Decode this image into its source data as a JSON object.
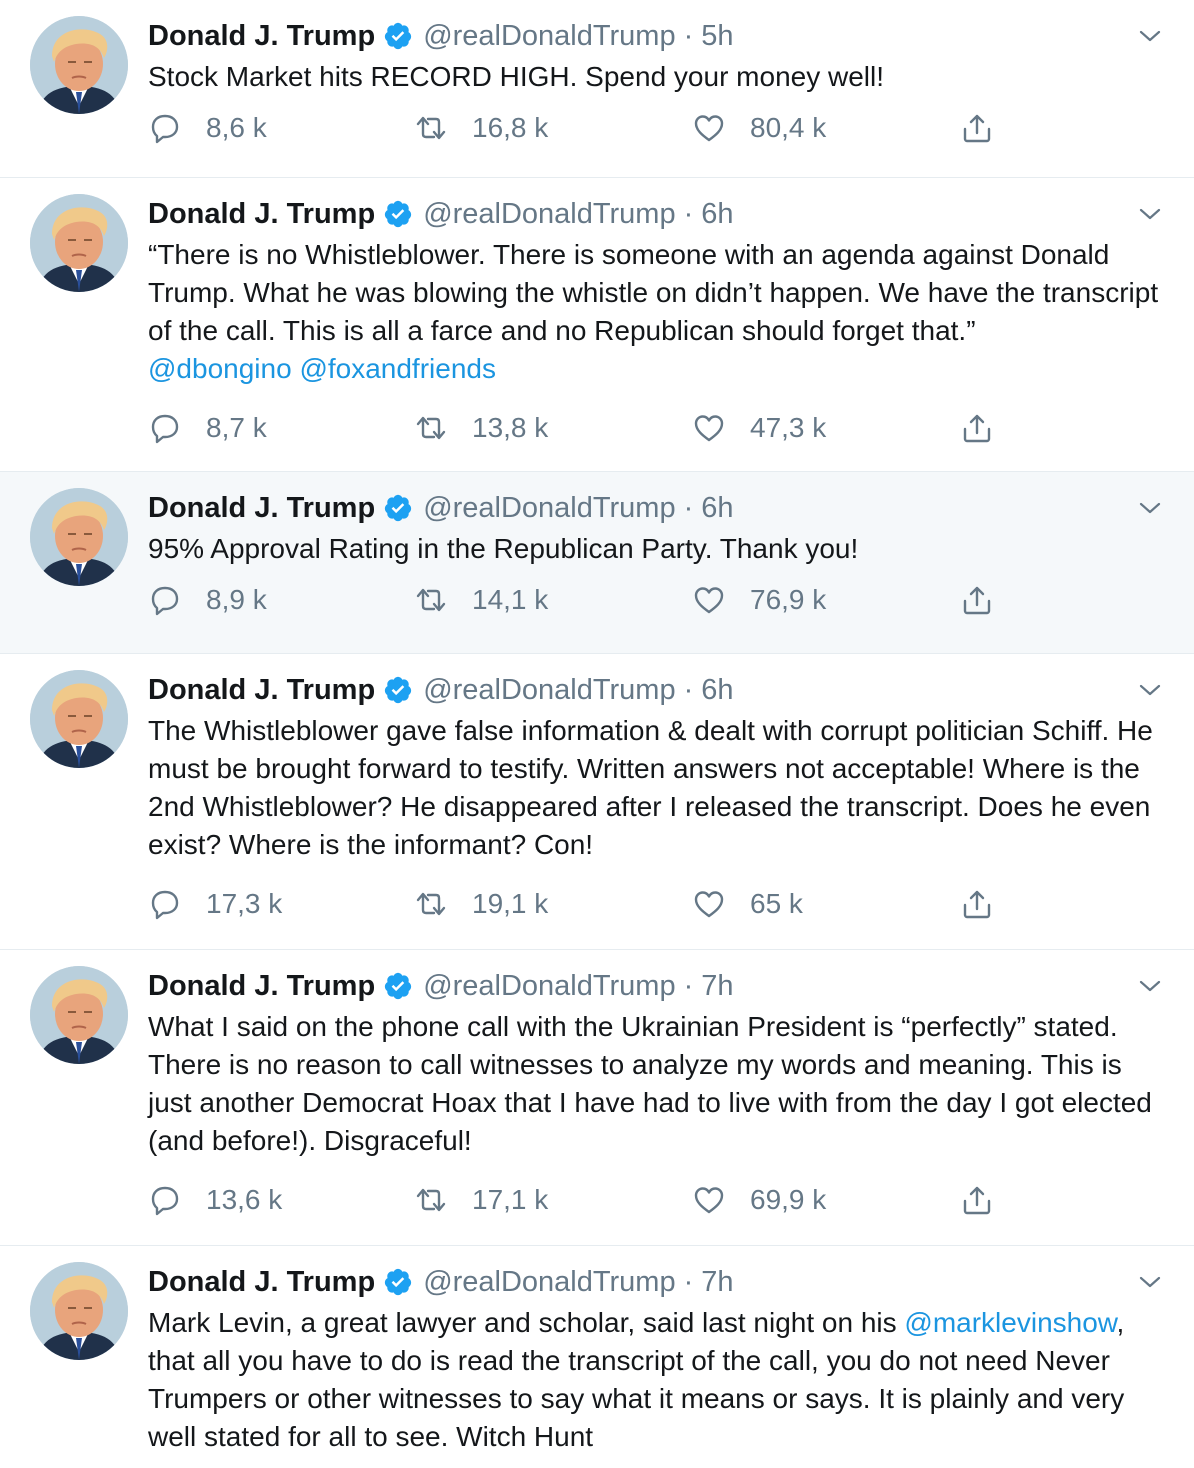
{
  "colors": {
    "text": "#14171a",
    "secondary": "#657786",
    "link": "#1b95e0",
    "verified": "#1da1f2",
    "divider": "#e6ecf0",
    "highlight_bg": "#f5f8fa"
  },
  "icons": {
    "reply": "speech-bubble-icon",
    "retweet": "retweet-icon",
    "like": "heart-icon",
    "share": "share-upload-icon",
    "verified": "verified-badge-icon",
    "caret": "chevron-down-icon"
  },
  "tweets": [
    {
      "name": "Donald J. Trump",
      "handle": "@realDonaldTrump",
      "dot": "·",
      "time": "5h",
      "text": "Stock Market hits RECORD HIGH. Spend your money well!",
      "replies": "8,6 k",
      "retweets": "16,8 k",
      "likes": "80,4 k"
    },
    {
      "name": "Donald J. Trump",
      "handle": "@realDonaldTrump",
      "dot": "·",
      "time": "6h",
      "text": "“There is no Whistleblower. There is someone with an agenda against Donald Trump. What he was blowing the whistle on didn’t happen. We have the transcript of the call. This is all a farce and no Republican should forget that.”",
      "mention_1": "@dbongino",
      "mention_2": "@foxandfriends",
      "replies": "8,7 k",
      "retweets": "13,8 k",
      "likes": "47,3 k"
    },
    {
      "name": "Donald J. Trump",
      "handle": "@realDonaldTrump",
      "dot": "·",
      "time": "6h",
      "text": "95% Approval Rating in the Republican Party. Thank you!",
      "replies": "8,9 k",
      "retweets": "14,1 k",
      "likes": "76,9 k"
    },
    {
      "name": "Donald J. Trump",
      "handle": "@realDonaldTrump",
      "dot": "·",
      "time": "6h",
      "text": "The Whistleblower gave false information & dealt with corrupt politician Schiff. He must be brought forward to testify. Written answers not acceptable! Where is the 2nd Whistleblower? He disappeared after I released the transcript. Does he even exist? Where is the informant? Con!",
      "replies": "17,3 k",
      "retweets": "19,1 k",
      "likes": "65 k"
    },
    {
      "name": "Donald J. Trump",
      "handle": "@realDonaldTrump",
      "dot": "·",
      "time": "7h",
      "text": "What I said on the phone call with the Ukrainian President is “perfectly” stated. There is no reason to call witnesses to analyze my words and meaning. This is just another Democrat Hoax that I have had to live with from the day I got elected (and before!). Disgraceful!",
      "replies": "13,6 k",
      "retweets": "17,1 k",
      "likes": "69,9 k"
    },
    {
      "name": "Donald J. Trump",
      "handle": "@realDonaldTrump",
      "dot": "·",
      "time": "7h",
      "text_before": "Mark Levin, a great lawyer and scholar, said last night on his ",
      "mention": "@marklevinshow",
      "text_after": ", that all you have to do is read the transcript of the call, you do not need Never Trumpers or other witnesses to say what it means or says. It is plainly and very well stated for all to see. Witch Hunt"
    }
  ]
}
